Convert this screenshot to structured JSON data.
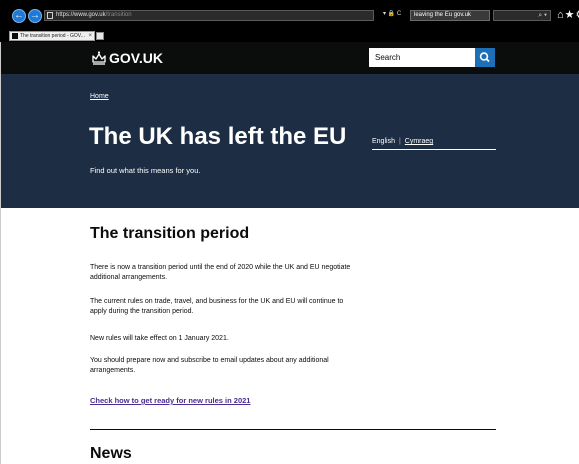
{
  "browser": {
    "url": "https://www.gov.uk",
    "url_suffix": "/transition",
    "address_controls": "▾ 🔒 C",
    "tab_search_text": "leaving the Eu gov.uk",
    "tab_title": "The transition period - GOV...",
    "search_glyph": "⌕ ▾",
    "toolbar_glyphs": "⌂★⚙"
  },
  "header": {
    "logo": "GOV.UK",
    "search_placeholder": "Search"
  },
  "hero": {
    "breadcrumb": "Home",
    "title": "The UK has left the EU",
    "subtitle": "Find out what this means for you.",
    "languages": {
      "current": "English",
      "other": "Cymraeg"
    }
  },
  "main": {
    "section_title": "The transition period",
    "paragraphs": [
      "There is now a transition period until the end of 2020 while the UK and EU negotiate additional arrangements.",
      "The current rules on trade, travel, and business for the UK and EU will continue to apply during the transition period.",
      "New rules will take effect on 1 January 2021.",
      "You should prepare now and subscribe to email updates about any additional arrangements."
    ],
    "cta_link": "Check how to get ready for new rules in 2021",
    "news_title": "News"
  },
  "colors": {
    "header_bg": "#0b0c0c",
    "hero_bg": "#1d2d44",
    "search_button": "#1d70b8",
    "link_visited": "#4c2c92"
  }
}
